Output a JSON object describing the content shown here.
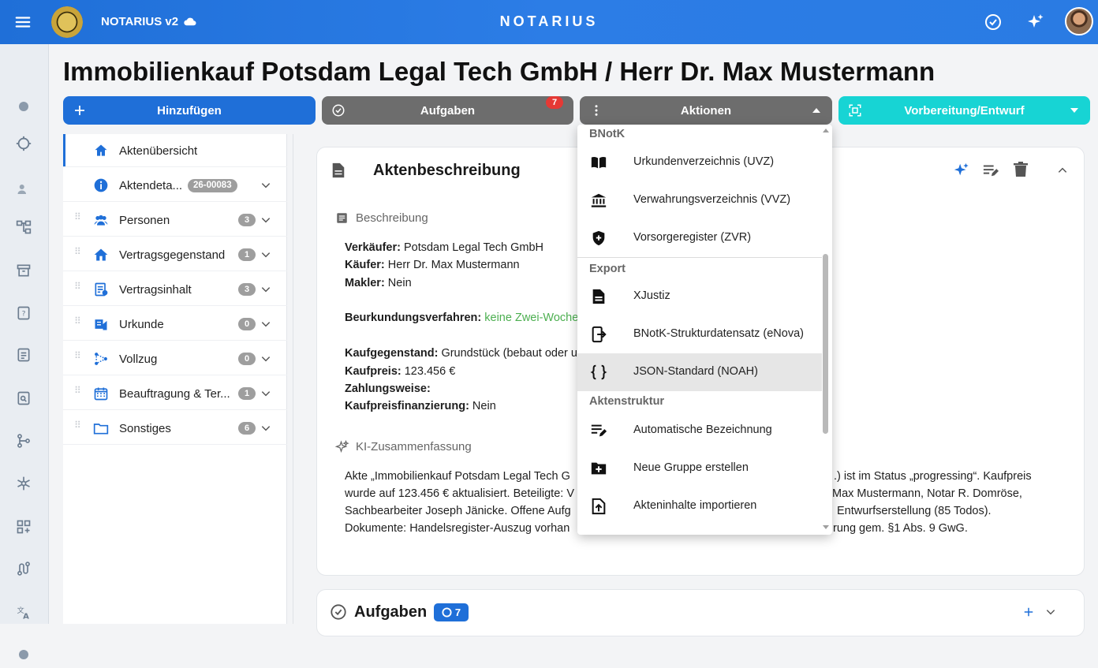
{
  "topbar": {
    "app_name": "NOTARIUS v2",
    "brand": "NOTARIUS"
  },
  "page": {
    "title": "Immobilienkauf Potsdam Legal Tech GmbH / Herr Dr. Max Mustermann"
  },
  "toolbar": {
    "add_label": "Hinzufügen",
    "tasks_label": "Aufgaben",
    "tasks_badge": "7",
    "actions_label": "Aktionen",
    "status_label": "Vorbereitung/Entwurf"
  },
  "sidebar": {
    "items": [
      {
        "label": "Aktenübersicht"
      },
      {
        "label": "Aktendeta...",
        "tag": "26-00083"
      },
      {
        "label": "Personen",
        "count": "3"
      },
      {
        "label": "Vertragsgegenstand",
        "count": "1"
      },
      {
        "label": "Vertragsinhalt",
        "count": "3"
      },
      {
        "label": "Urkunde",
        "count": "0"
      },
      {
        "label": "Vollzug",
        "count": "0"
      },
      {
        "label": "Beauftragung & Ter...",
        "count": "1"
      },
      {
        "label": "Sonstiges",
        "count": "6"
      }
    ]
  },
  "card": {
    "title": "Aktenbeschreibung",
    "section_desc": "Beschreibung",
    "verkaeufer_k": "Verkäufer:",
    "verkaeufer_v": " Potsdam Legal Tech GmbH",
    "kaeufer_k": "Käufer:",
    "kaeufer_v": " Herr Dr. Max Mustermann",
    "makler_k": "Makler:",
    "makler_v": " Nein",
    "verfahren_k": "Beurkundungsverfahren:",
    "verfahren_v": " keine Zwei-Woche",
    "gegenstand_k": "Kaufgegenstand:",
    "gegenstand_v": " Grundstück (bebaut oder u",
    "preis_k": "Kaufpreis:",
    "preis_v": " 123.456 €",
    "zahlung_k": "Zahlungsweise:",
    "finanz_k": "Kaufpreisfinanzierung:",
    "finanz_v": " Nein",
    "section_ki": "KI-Zusammenfassung",
    "ki_l1a": "Akte „Immobilienkauf Potsdam Legal Tech G",
    "ki_l1b": ".) ist im Status „progressing“. Kaufpreis",
    "ki_l2a": "wurde auf 123.456 € aktualisiert. Beteiligte: V",
    "ki_l2b": "Max Mustermann, Notar R. Domröse,",
    "ki_l3a": "Sachbearbeiter Joseph Jänicke. Offene Aufg",
    "ki_l3b": "Entwurfserstellung (85 Todos).",
    "ki_l4a": "Dokumente: Handelsregister-Auszug vorhan",
    "ki_l4b": "rung gem. §1 Abs. 9 GwG."
  },
  "card2": {
    "title": "Aufgaben",
    "badge": "7"
  },
  "menu": {
    "h1": "BNotK",
    "i1": "Urkundenverzeichnis (UVZ)",
    "i2": "Verwahrungsverzeichnis (VVZ)",
    "i3": "Vorsorgeregister (ZVR)",
    "h2": "Export",
    "i4": "XJustiz",
    "i5": "BNotK-Strukturdatensatz (eNova)",
    "i6": "JSON-Standard (NOAH)",
    "h3": "Aktenstruktur",
    "i7": "Automatische Bezeichnung",
    "i8": "Neue Gruppe erstellen",
    "i9": "Akteninhalte importieren"
  },
  "colors": {
    "primary": "#1f6fd8",
    "grey_button": "#6d6d6d",
    "teal": "#17d4d4",
    "badge_red": "#e53935",
    "link_green": "#4caf50"
  }
}
